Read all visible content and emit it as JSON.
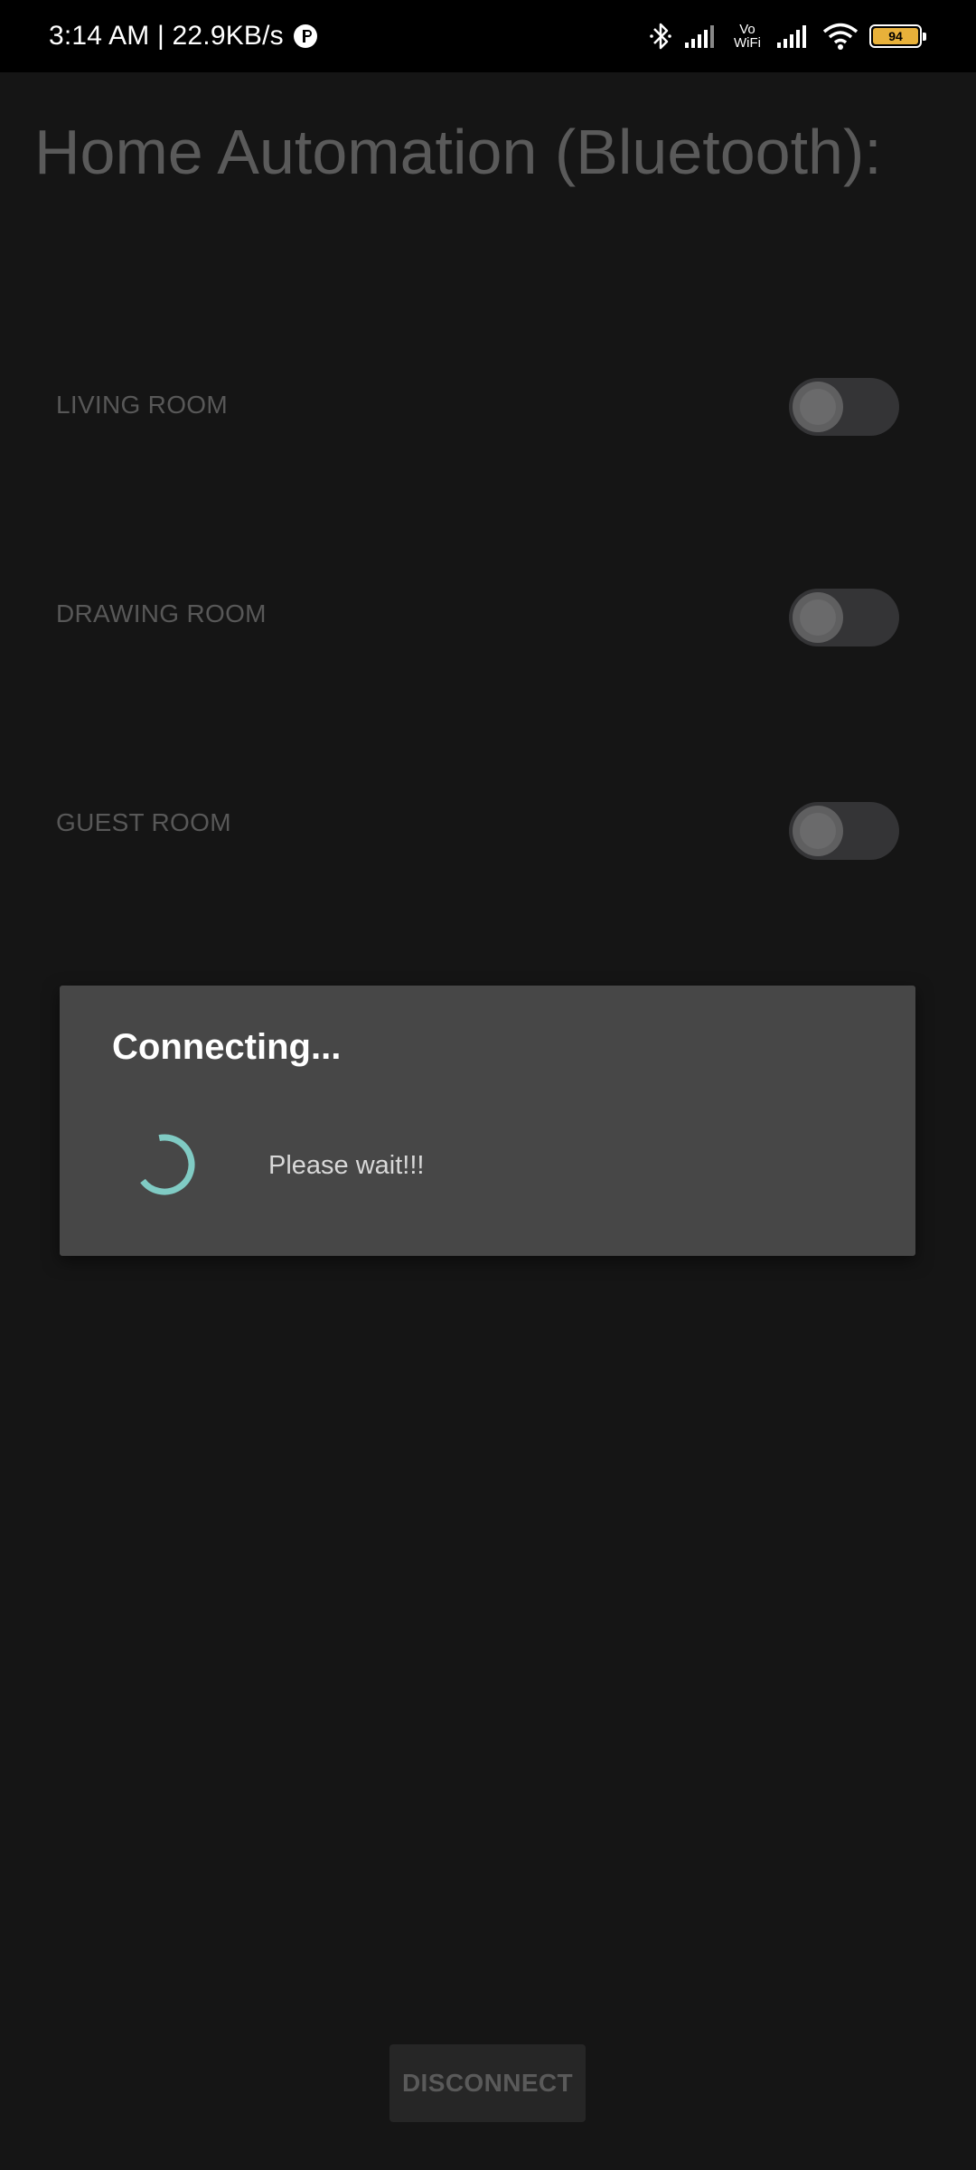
{
  "status_bar": {
    "time_speed": "3:14 AM | 22.9KB/s",
    "vowifi_top": "Vo",
    "vowifi_bottom": "WiFi",
    "battery": "94"
  },
  "app": {
    "title": "Home Automation (Bluetooth):",
    "rooms": [
      {
        "label": "LIVING ROOM",
        "on": false
      },
      {
        "label": "DRAWING ROOM",
        "on": false
      },
      {
        "label": "GUEST ROOM",
        "on": false
      }
    ],
    "disconnect_label": "DISCONNECT"
  },
  "dialog": {
    "title": "Connecting...",
    "message": "Please wait!!!"
  },
  "colors": {
    "accent": "#80cbc4",
    "dialog_bg": "#474747",
    "screen_bg": "#151515"
  }
}
